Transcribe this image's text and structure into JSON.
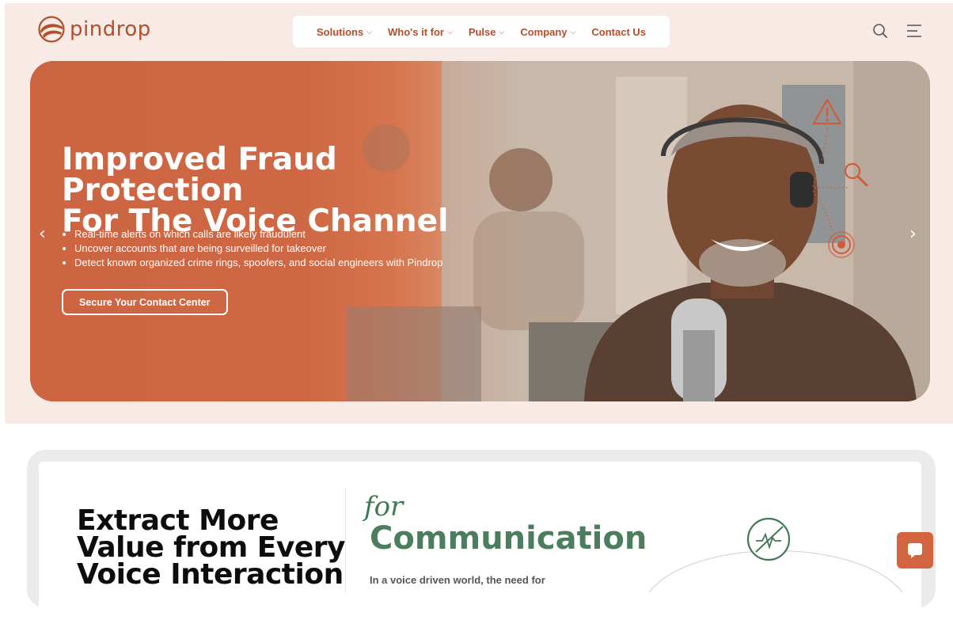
{
  "header": {
    "logo_text": "pindrop",
    "nav": [
      {
        "label": "Solutions",
        "has_dropdown": true
      },
      {
        "label": "Who's it for",
        "has_dropdown": true
      },
      {
        "label": "Pulse",
        "has_dropdown": true
      },
      {
        "label": "Company",
        "has_dropdown": true
      },
      {
        "label": "Contact Us",
        "has_dropdown": false
      }
    ],
    "icons": [
      "search-icon",
      "menu-icon"
    ]
  },
  "hero": {
    "title_line1": "Improved Fraud Protection",
    "title_line2": "For The Voice Channel",
    "bullets": [
      "Real-time alerts on which calls are likely fraudulent",
      "Uncover accounts that are being surveilled for takeover",
      "Detect known organized crime rings, spoofers, and social engineers with Pindrop"
    ],
    "cta_label": "Secure Your Contact Center",
    "icons": [
      "warning-icon",
      "magnifier-icon",
      "target-icon",
      "chevron-left-icon",
      "chevron-right-icon"
    ]
  },
  "section": {
    "heading_line1": "Extract More",
    "heading_line2": "Value from Every",
    "heading_line3": "Voice Interaction",
    "script_word": "for",
    "title": "Communication",
    "lead_text": "In a voice driven world, the need for"
  },
  "chat_icon": "chat-bubble-icon",
  "colors": {
    "brand": "#b14f2c",
    "hero_orange": "#cd6542",
    "band_bg": "#f8ebe5",
    "green": "#4a7e5c"
  }
}
